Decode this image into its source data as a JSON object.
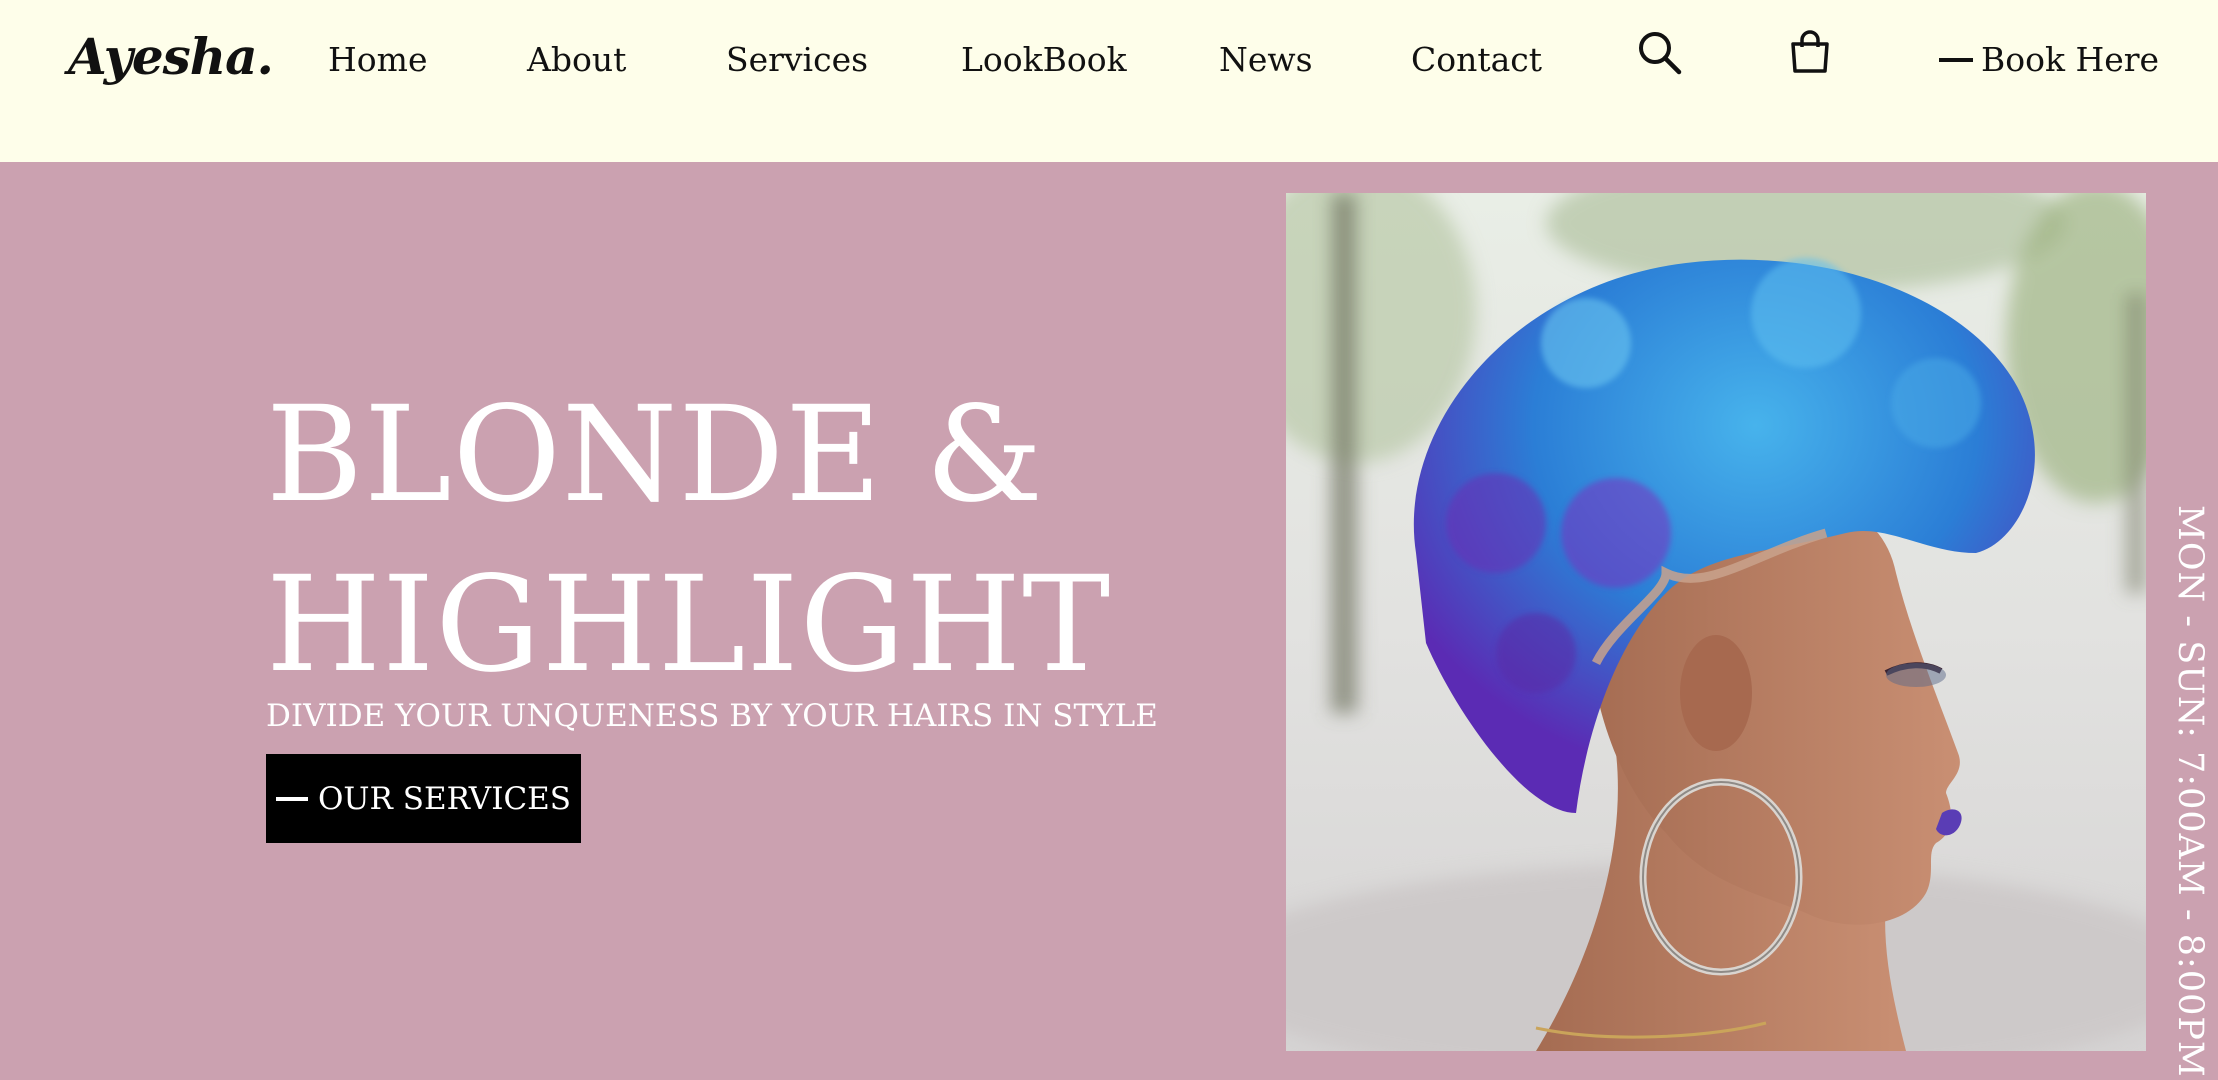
{
  "brand": {
    "logo": "Ayesha."
  },
  "nav": {
    "items": [
      {
        "label": "Home"
      },
      {
        "label": "About"
      },
      {
        "label": "Services"
      },
      {
        "label": "LookBook"
      },
      {
        "label": "News"
      },
      {
        "label": "Contact"
      }
    ],
    "search_icon": "search-icon",
    "cart_icon": "shopping-bag-icon",
    "book_label": "Book Here"
  },
  "hero": {
    "title_line1": "BLONDE &",
    "title_line2": "HIGHLIGHT",
    "subtitle": "DIVIDE YOUR UNQUENESS BY YOUR HAIRS IN STYLE",
    "cta_label": "OUR SERVICES",
    "hours": "MON - SUN: 7:00AM - 8:00PM"
  },
  "colors": {
    "header_bg": "#fefeea",
    "hero_bg": "#cba1b0",
    "button_bg": "#000000",
    "text_light": "#ffffff",
    "text_dark": "#111111"
  }
}
